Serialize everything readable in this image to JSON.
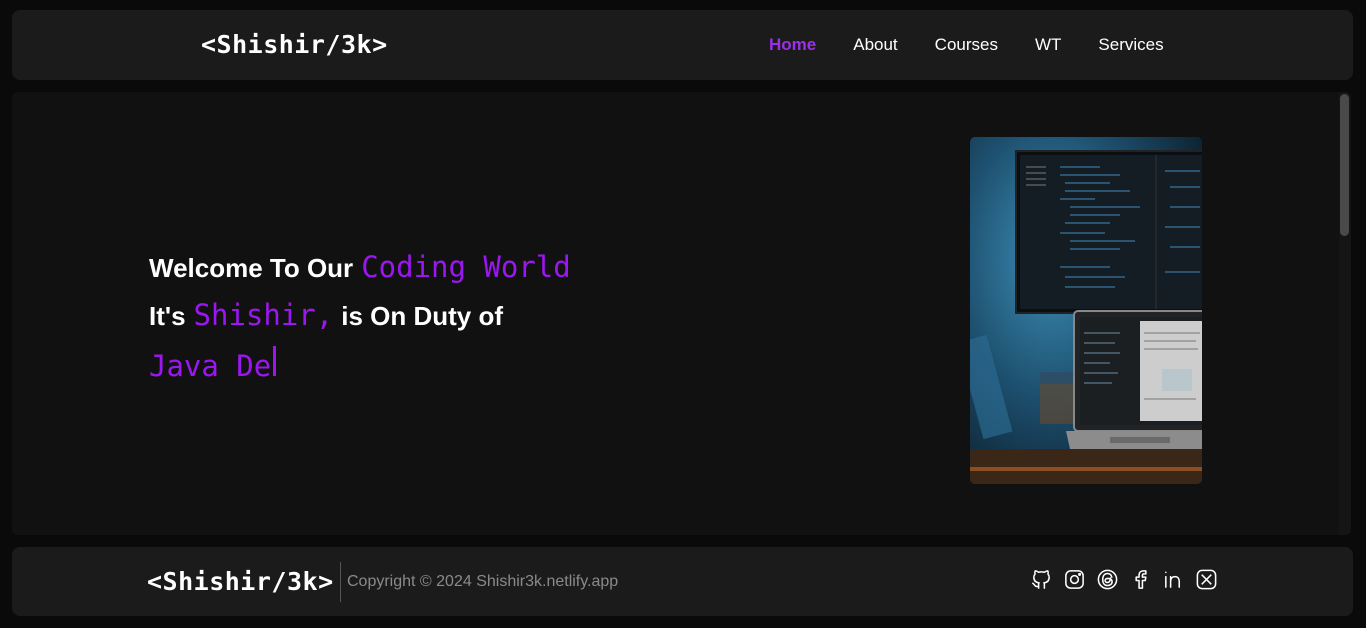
{
  "nav": {
    "logo": "<Shishir/3k>",
    "links": [
      {
        "label": "Home",
        "active": true
      },
      {
        "label": "About",
        "active": false
      },
      {
        "label": "Courses",
        "active": false
      },
      {
        "label": "WT",
        "active": false
      },
      {
        "label": "Services",
        "active": false
      }
    ]
  },
  "hero": {
    "line1_plain": "Welcome To Our",
    "line1_accent": "Coding World",
    "line2_plain_a": "It's",
    "line2_accent": "Shishir,",
    "line2_plain_b": "is On Duty of",
    "typed_text": "Java De",
    "image_icon": "desk-monitor-laptop-photo"
  },
  "footer": {
    "logo": "<Shishir/3k>",
    "copyright": "Copyright © 2024 Shishir3k.netlify.app",
    "socials": [
      "github-icon",
      "instagram-icon",
      "threads-icon",
      "facebook-icon",
      "linkedin-icon",
      "x-icon"
    ]
  },
  "colors": {
    "accent": "#9b16f0",
    "nav_active": "#9b30e8",
    "panel": "#1b1b1b",
    "background": "#111111"
  }
}
